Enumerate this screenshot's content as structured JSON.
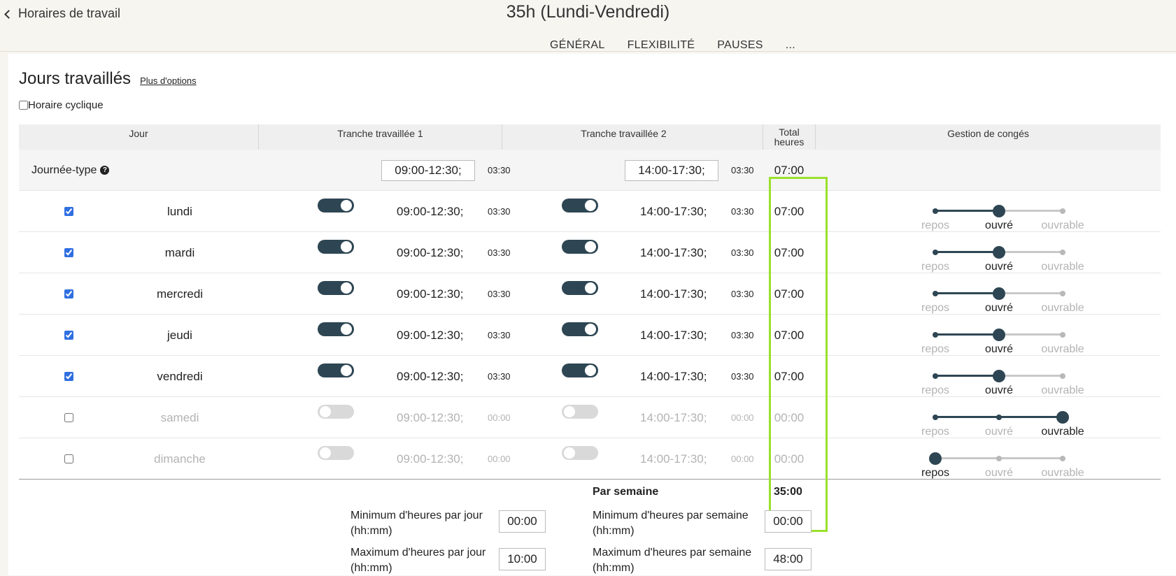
{
  "header": {
    "back_label": "Horaires de travail",
    "title": "35h (Lundi-Vendredi)",
    "tabs": [
      "GÉNÉRAL",
      "FLEXIBILITÉ",
      "PAUSES",
      "..."
    ]
  },
  "section": {
    "title": "Jours travaillés",
    "more_options": "Plus d'options",
    "cyclic_label": "Horaire cyclique"
  },
  "table": {
    "headers": {
      "day": "Jour",
      "slot1": "Tranche travaillée 1",
      "slot2": "Tranche travaillée 2",
      "total_line1": "Total",
      "total_line2": "heures",
      "leave": "Gestion de congés"
    },
    "typical": {
      "label": "Journée-type",
      "slot1": "09:00-12:30;",
      "dur1": "03:30",
      "slot2": "14:00-17:30;",
      "dur2": "03:30",
      "total": "07:00"
    },
    "slider_labels": [
      "repos",
      "ouvré",
      "ouvrable"
    ],
    "rows": [
      {
        "day": "lundi",
        "checked": true,
        "slot1": "09:00-12:30;",
        "dur1": "03:30",
        "slot2": "14:00-17:30;",
        "dur2": "03:30",
        "total": "07:00",
        "leave": "ouvré"
      },
      {
        "day": "mardi",
        "checked": true,
        "slot1": "09:00-12:30;",
        "dur1": "03:30",
        "slot2": "14:00-17:30;",
        "dur2": "03:30",
        "total": "07:00",
        "leave": "ouvré"
      },
      {
        "day": "mercredi",
        "checked": true,
        "slot1": "09:00-12:30;",
        "dur1": "03:30",
        "slot2": "14:00-17:30;",
        "dur2": "03:30",
        "total": "07:00",
        "leave": "ouvré"
      },
      {
        "day": "jeudi",
        "checked": true,
        "slot1": "09:00-12:30;",
        "dur1": "03:30",
        "slot2": "14:00-17:30;",
        "dur2": "03:30",
        "total": "07:00",
        "leave": "ouvré"
      },
      {
        "day": "vendredi",
        "checked": true,
        "slot1": "09:00-12:30;",
        "dur1": "03:30",
        "slot2": "14:00-17:30;",
        "dur2": "03:30",
        "total": "07:00",
        "leave": "ouvré"
      },
      {
        "day": "samedi",
        "checked": false,
        "slot1": "09:00-12:30;",
        "dur1": "00:00",
        "slot2": "14:00-17:30;",
        "dur2": "00:00",
        "total": "00:00",
        "leave": "ouvrable"
      },
      {
        "day": "dimanche",
        "checked": false,
        "slot1": "09:00-12:30;",
        "dur1": "00:00",
        "slot2": "14:00-17:30;",
        "dur2": "00:00",
        "total": "00:00",
        "leave": "repos"
      }
    ]
  },
  "summary": {
    "per_week_label": "Par semaine",
    "per_week_total": "35:00",
    "min_day_label_1": "Minimum d'heures par jour",
    "min_day_label_2": "(hh:mm)",
    "min_day_value": "00:00",
    "max_day_label_1": "Maximum d'heures par jour",
    "max_day_label_2": "(hh:mm)",
    "max_day_value": "10:00",
    "min_week_label_1": "Minimum d'heures par semaine",
    "min_week_label_2": "(hh:mm)",
    "min_week_value": "00:00",
    "max_week_label_1": "Maximum d'heures par semaine",
    "max_week_label_2": "(hh:mm)",
    "max_week_value": "48:00"
  },
  "colors": {
    "accent": "#2e4653",
    "highlight": "#9be02b",
    "checkbox": "#2f6fe0",
    "muted": "#b3b3b3"
  }
}
